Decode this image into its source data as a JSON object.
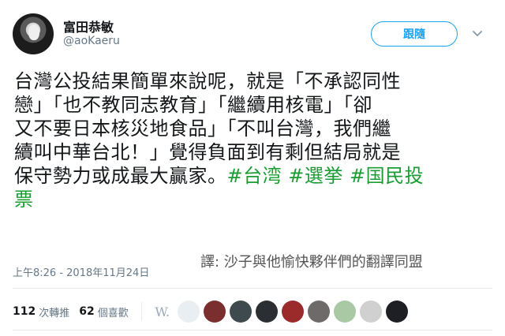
{
  "user": {
    "display_name": "富田恭敏",
    "handle": "@aoKaeru"
  },
  "follow_button": {
    "label": "跟隨"
  },
  "icons": {
    "avatar": "profile-photo",
    "menu": "chevron-down-icon"
  },
  "tweet": {
    "line1": "台灣公投結果簡單來說呢，就是「不承認同性",
    "line2": "戀」「也不教同志教育」「繼續用核電」「卻",
    "line3": "又不要日本核災地食品」「不叫台灣，我們繼",
    "line4": "續叫中華台北！」覺得負面到有剩但結局就是",
    "line5": "保守勢力或成最大贏家。",
    "hashtag1": "#台湾",
    "hashtag2": "#選挙",
    "hashtag3": "#国民投",
    "line6": "票",
    "hashtag_color": "#1b9c33"
  },
  "translation_credit": "譯: 沙子與他愉快夥伴們的翻譯同盟",
  "timestamp": "上午8:26 - 2018年11月24日",
  "stats": {
    "retweets_count": "112",
    "retweets_label": "次轉推",
    "likes_count": "62",
    "likes_label": "個喜歡"
  },
  "likers": [
    {
      "name": "liker-1",
      "letter": "W."
    },
    {
      "name": "liker-2",
      "color": "#e9eef2"
    },
    {
      "name": "liker-3",
      "color": "#7a2e2e"
    },
    {
      "name": "liker-4",
      "color": "#3f4a4e"
    },
    {
      "name": "liker-5",
      "color": "#2b2f33"
    },
    {
      "name": "liker-6",
      "color": "#9b2a2a"
    },
    {
      "name": "liker-7",
      "color": "#6f6a6a"
    },
    {
      "name": "liker-8",
      "color": "#a9c9a4"
    },
    {
      "name": "liker-9",
      "color": "#d0d0d0"
    },
    {
      "name": "liker-10",
      "color": "#1d1f24"
    }
  ]
}
